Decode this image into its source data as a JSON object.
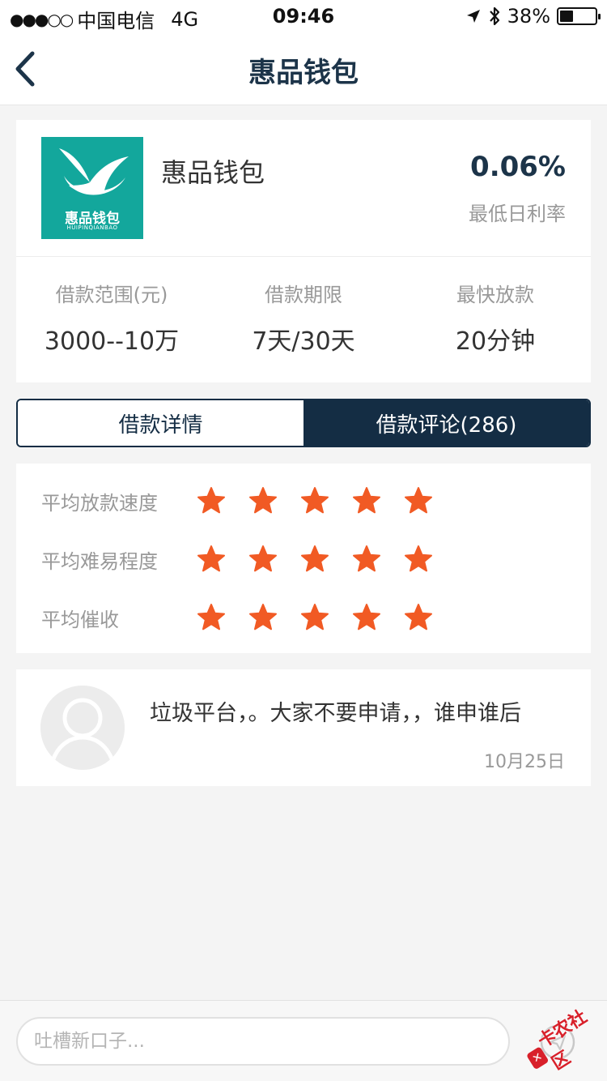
{
  "status_bar": {
    "signal": "●●●○○",
    "carrier": "中国电信",
    "network": "4G",
    "time": "09:46",
    "battery_percent": "38%",
    "battery_level": 0.38,
    "icons": [
      "location-arrow-icon",
      "bluetooth-icon",
      "battery-icon"
    ]
  },
  "nav": {
    "title": "惠品钱包",
    "back_icon": "chevron-left-icon"
  },
  "product": {
    "name": "惠品钱包",
    "logo_title": "惠品钱包",
    "logo_subtitle": "HUIPINQIANBAO",
    "rate_value": "0.06%",
    "rate_label": "最低日利率",
    "info": [
      {
        "label": "借款范围(元)",
        "value": "3000--10万"
      },
      {
        "label": "借款期限",
        "value": "7天/30天"
      },
      {
        "label": "最快放款",
        "value": "20分钟"
      }
    ]
  },
  "tabs": [
    {
      "label": "借款详情",
      "active": false
    },
    {
      "label": "借款评论(286)",
      "active": true
    }
  ],
  "ratings": [
    {
      "label": "平均放款速度",
      "stars": 5
    },
    {
      "label": "平均难易程度",
      "stars": 5
    },
    {
      "label": "平均催收",
      "stars": 5
    }
  ],
  "comment": {
    "text": "垃圾平台，。大家不要申请，，谁申谁后",
    "date": "10月25日"
  },
  "bottom": {
    "input_placeholder": "吐槽新口子...",
    "watermark": "卡农社区"
  },
  "colors": {
    "primary": "#142d44",
    "star": "#f15a24",
    "logo_bg": "#13a79c"
  }
}
